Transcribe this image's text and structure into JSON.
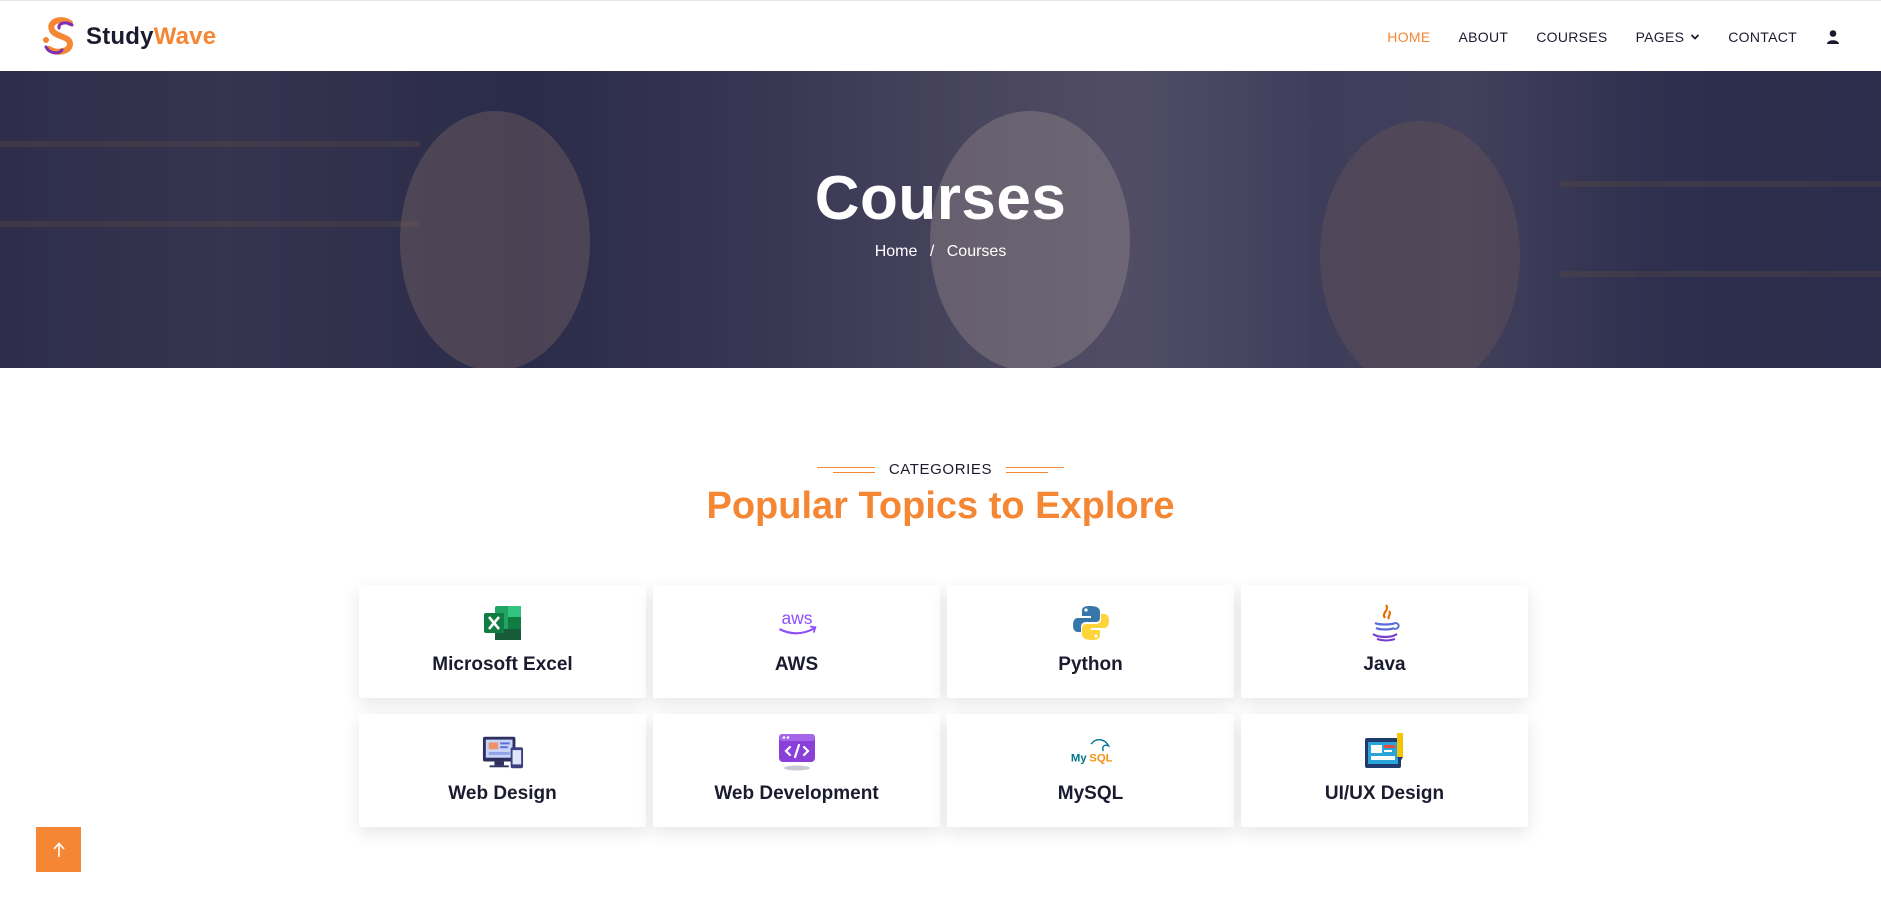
{
  "brand": {
    "name_part1": "Study",
    "name_part2": "Wave",
    "primary_color": "#f58634",
    "text_color": "#1b1b2f"
  },
  "nav": {
    "items": [
      {
        "label": "HOME",
        "active": true
      },
      {
        "label": "ABOUT",
        "active": false
      },
      {
        "label": "COURSES",
        "active": false
      },
      {
        "label": "PAGES",
        "active": false,
        "dropdown": true
      },
      {
        "label": "CONTACT",
        "active": false
      }
    ],
    "user_icon": "user-icon"
  },
  "hero": {
    "title": "Courses",
    "breadcrumb": {
      "home": "Home",
      "separator": "/",
      "current": "Courses"
    }
  },
  "categories": {
    "eyebrow": "CATEGORIES",
    "title": "Popular Topics to Explore",
    "items": [
      {
        "label": "Microsoft Excel",
        "icon": "excel-icon"
      },
      {
        "label": "AWS",
        "icon": "aws-icon"
      },
      {
        "label": "Python",
        "icon": "python-icon"
      },
      {
        "label": "Java",
        "icon": "java-icon"
      },
      {
        "label": "Web Design",
        "icon": "web-design-icon"
      },
      {
        "label": "Web Development",
        "icon": "web-development-icon"
      },
      {
        "label": "MySQL",
        "icon": "mysql-icon"
      },
      {
        "label": "UI/UX Design",
        "icon": "ui-ux-design-icon"
      }
    ]
  },
  "scroll_top": {
    "icon": "arrow-up-icon"
  }
}
